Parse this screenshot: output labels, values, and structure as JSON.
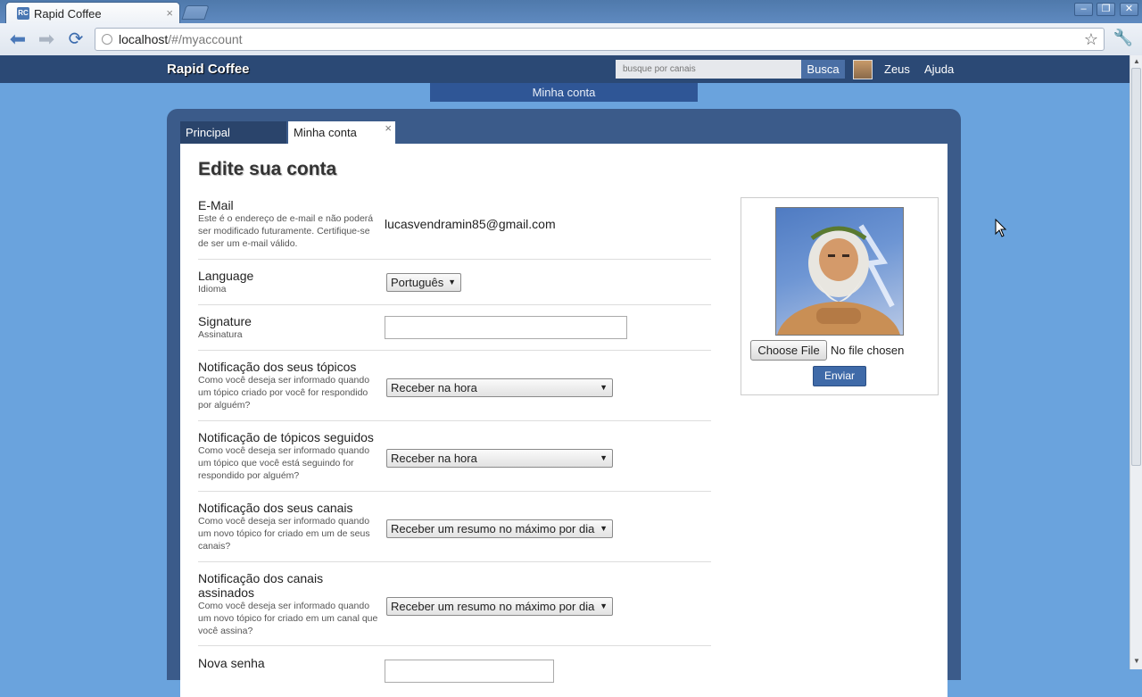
{
  "browser": {
    "tab_title": "Rapid Coffee",
    "favicon_text": "RC",
    "url_host": "localhost",
    "url_path": "/#/myaccount"
  },
  "header": {
    "brand": "Rapid Coffee",
    "search_placeholder": "busque por canais",
    "search_button": "Busca",
    "user": "Zeus",
    "help": "Ajuda"
  },
  "breadcrumb": "Minha conta",
  "tabs": [
    {
      "label": "Principal"
    },
    {
      "label": "Minha conta",
      "close": "×"
    }
  ],
  "form": {
    "title": "Edite sua conta",
    "email": {
      "label": "E-Mail",
      "hint": "Este é o endereço de e-mail e não poderá ser modificado futuramente. Certifique-se de ser um e-mail válido.",
      "value": "lucasvendramin85@gmail.com"
    },
    "language": {
      "label": "Language",
      "hint": "Idioma",
      "value": "Português"
    },
    "signature": {
      "label": "Signature",
      "hint": "Assinatura",
      "value": ""
    },
    "notif_own_topics": {
      "label": "Notificação dos seus tópicos",
      "hint": "Como você deseja ser informado quando um tópico criado por você for respondido por alguém?",
      "value": "Receber na hora"
    },
    "notif_followed_topics": {
      "label": "Notificação de tópicos seguidos",
      "hint": "Como você deseja ser informado quando um tópico que você está seguindo for respondido por alguém?",
      "value": "Receber na hora"
    },
    "notif_own_channels": {
      "label": "Notificação dos seus canais",
      "hint": "Como você deseja ser informado quando um novo tópico for criado em um de seus canais?",
      "value": "Receber um resumo no máximo por dia"
    },
    "notif_subscribed_channels": {
      "label": "Notificação dos canais assinados",
      "hint": "Como você deseja ser informado quando um novo tópico for criado em um canal que você assina?",
      "value": "Receber um resumo no máximo por dia"
    },
    "new_password": {
      "label": "Nova senha"
    }
  },
  "photo": {
    "choose_button": "Choose File",
    "file_status": "No file chosen",
    "submit_button": "Enviar"
  }
}
